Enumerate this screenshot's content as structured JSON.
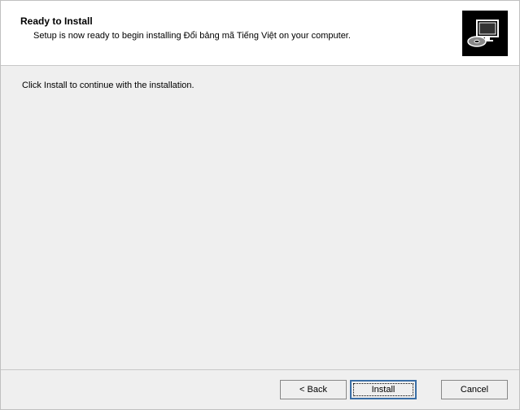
{
  "header": {
    "title": "Ready to Install",
    "subtitle": "Setup is now ready to begin installing Đổi bảng mã Tiếng Việt on your computer."
  },
  "content": {
    "instruction": "Click Install to continue with the installation."
  },
  "footer": {
    "back_label": "< Back",
    "install_label": "Install",
    "cancel_label": "Cancel"
  }
}
